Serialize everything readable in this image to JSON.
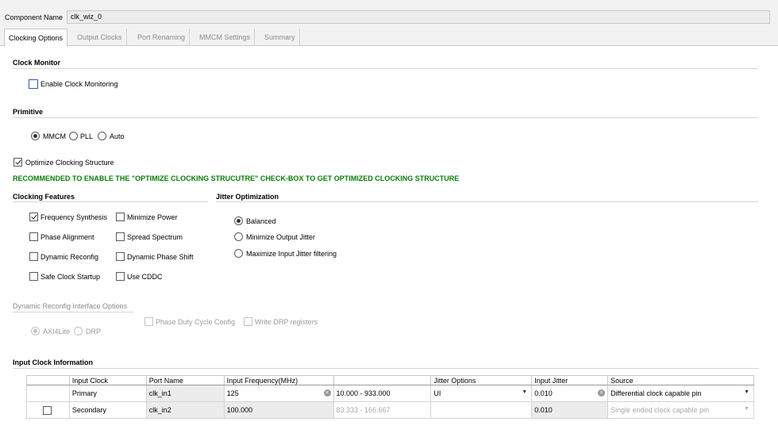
{
  "component": {
    "label": "Component Name",
    "value": "clk_wiz_0"
  },
  "tabs": [
    {
      "label": "Clocking Options",
      "active": true
    },
    {
      "label": "Output Clocks",
      "active": false
    },
    {
      "label": "Port Renaming",
      "active": false
    },
    {
      "label": "MMCM Settings",
      "active": false
    },
    {
      "label": "Summary",
      "active": false
    }
  ],
  "clock_monitor": {
    "title": "Clock Monitor",
    "enable_label": "Enable Clock Monitoring",
    "enabled": false
  },
  "primitive": {
    "title": "Primitive",
    "options": [
      "MMCM",
      "PLL",
      "Auto"
    ],
    "selected": "MMCM"
  },
  "optimize": {
    "label": "Optimize Clocking Structure",
    "checked": true,
    "recommendation": "RECOMMENDED TO ENABLE THE \"OPTIMIZE CLOCKING STRUCUTRE\" CHECK-BOX TO GET OPTIMIZED CLOCKING STRUCTURE"
  },
  "clocking_features": {
    "title": "Clocking Features",
    "items": [
      {
        "label": "Frequency Synthesis",
        "checked": true
      },
      {
        "label": "Minimize Power",
        "checked": false
      },
      {
        "label": "Phase Alignment",
        "checked": false
      },
      {
        "label": "Spread Spectrum",
        "checked": false
      },
      {
        "label": "Dynamic Reconfig",
        "checked": false
      },
      {
        "label": "Dynamic Phase Shift",
        "checked": false
      },
      {
        "label": "Safe Clock Startup",
        "checked": false
      },
      {
        "label": "Use CDDC",
        "checked": false
      }
    ]
  },
  "jitter_optimization": {
    "title": "Jitter Optimization",
    "options": [
      "Balanced",
      "Minimize Output Jitter",
      "Maximize Input Jitter filtering"
    ],
    "selected": "Balanced"
  },
  "dynamic_reconfig": {
    "title": "Dynamic Reconfig Interface Options",
    "options": [
      "AXI4Lite",
      "DRP"
    ],
    "selected": "AXI4Lite",
    "phase_duty_label": "Phase Duty Cycle Config",
    "write_drp_label": "Write DRP registers"
  },
  "input_clock": {
    "title": "Input Clock Information",
    "columns": [
      "",
      "Input Clock",
      "Port Name",
      "Input Frequency(MHz)",
      "",
      "Jitter Options",
      "Input Jitter",
      "Source"
    ],
    "rows": [
      {
        "checkbox": false,
        "input_clock": "Primary",
        "port_name": "clk_in1",
        "frequency": "125",
        "range": "10.000 - 933.000",
        "jitter_options": "UI",
        "input_jitter": "0.010",
        "source": "Differential clock capable pin"
      },
      {
        "checkbox": true,
        "input_clock": "Secondary",
        "port_name": "clk_in2",
        "frequency": "100.000",
        "range": "83.333 - 166.667",
        "jitter_options": "",
        "input_jitter": "0.010",
        "source": "Single ended clock capable pin"
      }
    ]
  },
  "colors": {
    "recommendation": "#0a7d0a",
    "checkbox_focus": "#2b5ea8"
  }
}
